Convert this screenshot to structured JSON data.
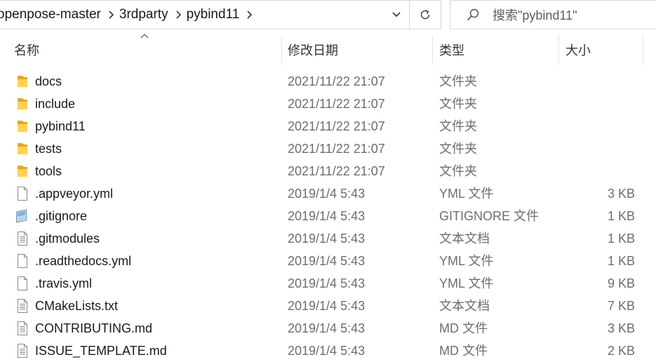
{
  "breadcrumb": [
    "openpose-master",
    "3rdparty",
    "pybind11"
  ],
  "search": {
    "placeholder": "搜索\"pybind11\""
  },
  "columns": {
    "name": "名称",
    "date": "修改日期",
    "type": "类型",
    "size": "大小"
  },
  "files": [
    {
      "name": "docs",
      "date": "2021/11/22 21:07",
      "type": "文件夹",
      "size": "",
      "icon": "folder-icon"
    },
    {
      "name": "include",
      "date": "2021/11/22 21:07",
      "type": "文件夹",
      "size": "",
      "icon": "folder-icon"
    },
    {
      "name": "pybind11",
      "date": "2021/11/22 21:07",
      "type": "文件夹",
      "size": "",
      "icon": "folder-icon"
    },
    {
      "name": "tests",
      "date": "2021/11/22 21:07",
      "type": "文件夹",
      "size": "",
      "icon": "folder-icon"
    },
    {
      "name": "tools",
      "date": "2021/11/22 21:07",
      "type": "文件夹",
      "size": "",
      "icon": "folder-icon"
    },
    {
      "name": ".appveyor.yml",
      "date": "2019/1/4 5:43",
      "type": "YML 文件",
      "size": "3 KB",
      "icon": "file-icon"
    },
    {
      "name": ".gitignore",
      "date": "2019/1/4 5:43",
      "type": "GITIGNORE 文件",
      "size": "1 KB",
      "icon": "gitignore-file-icon"
    },
    {
      "name": ".gitmodules",
      "date": "2019/1/4 5:43",
      "type": "文本文档",
      "size": "1 KB",
      "icon": "text-file-icon"
    },
    {
      "name": ".readthedocs.yml",
      "date": "2019/1/4 5:43",
      "type": "YML 文件",
      "size": "1 KB",
      "icon": "file-icon"
    },
    {
      "name": ".travis.yml",
      "date": "2019/1/4 5:43",
      "type": "YML 文件",
      "size": "9 KB",
      "icon": "file-icon"
    },
    {
      "name": "CMakeLists.txt",
      "date": "2019/1/4 5:43",
      "type": "文本文档",
      "size": "7 KB",
      "icon": "text-file-icon"
    },
    {
      "name": "CONTRIBUTING.md",
      "date": "2019/1/4 5:43",
      "type": "MD 文件",
      "size": "3 KB",
      "icon": "text-file-icon"
    },
    {
      "name": "ISSUE_TEMPLATE.md",
      "date": "2019/1/4 5:43",
      "type": "MD 文件",
      "size": "2 KB",
      "icon": "text-file-icon"
    }
  ]
}
